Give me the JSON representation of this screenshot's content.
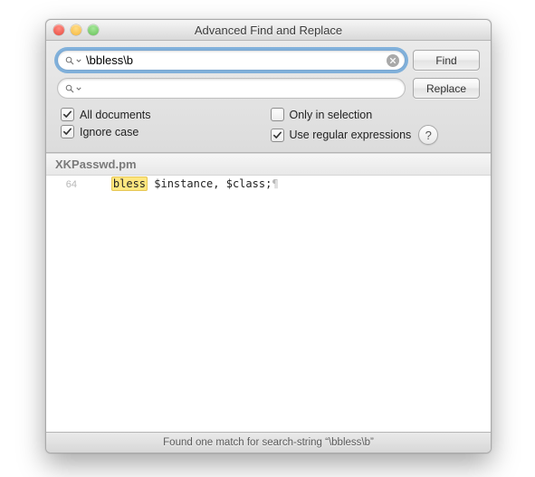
{
  "window": {
    "title": "Advanced Find and Replace"
  },
  "search": {
    "find_value": "\\bbless\\b",
    "replace_value": "",
    "find_button": "Find",
    "replace_button": "Replace"
  },
  "options": {
    "all_documents": {
      "label": "All documents",
      "checked": true
    },
    "ignore_case": {
      "label": "Ignore case",
      "checked": true
    },
    "only_in_selection": {
      "label": "Only in selection",
      "checked": false
    },
    "use_regex": {
      "label": "Use regular expressions",
      "checked": true
    }
  },
  "results": {
    "file": "XKPasswd.pm",
    "line_number": "64",
    "prefix": "    ",
    "match": "bless",
    "suffix": " $instance, $class;",
    "eol": "¶"
  },
  "status": "Found one match for search-string “\\bbless\\b”"
}
